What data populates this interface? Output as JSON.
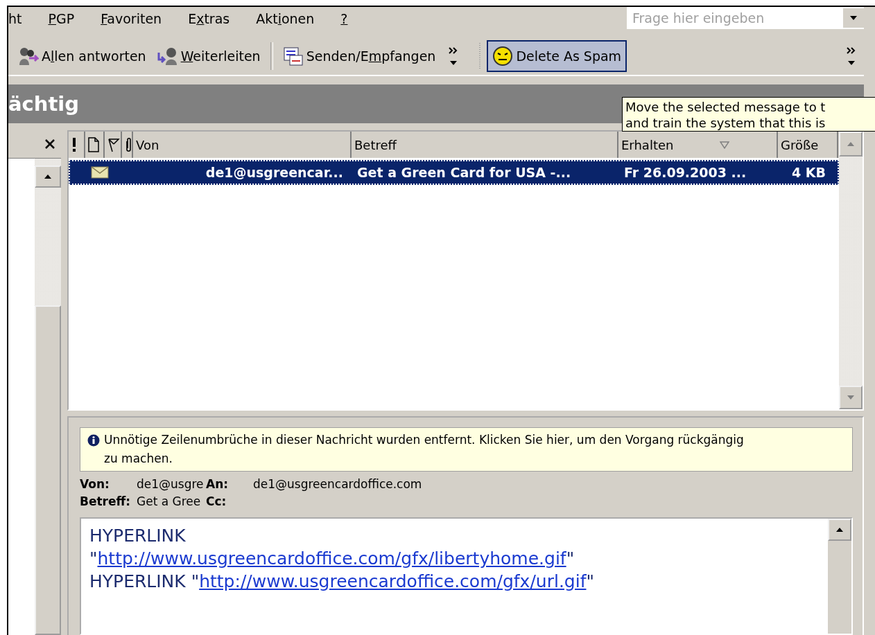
{
  "menu": [
    {
      "pre": "ht"
    },
    {
      "key": "P",
      "post": "GP"
    },
    {
      "key": "F",
      "post": "avoriten"
    },
    {
      "pre": "E",
      "key": "x",
      "post": "tras"
    },
    {
      "pre": "Akt",
      "key": "i",
      "post": "onen"
    },
    {
      "key": "?"
    }
  ],
  "ask_field": {
    "placeholder": "Frage hier eingeben"
  },
  "toolbar": [
    {
      "kind": "reply-all",
      "pre": "A",
      "key": "l",
      "post": "len antworten",
      "selected": false
    },
    {
      "kind": "forward",
      "key": "W",
      "post": "eiterleiten",
      "selected": false
    },
    {
      "kind": "separator"
    },
    {
      "kind": "send-receive",
      "pre": "Senden/E",
      "key": "m",
      "post": "pfangen",
      "selected": false
    },
    {
      "kind": "chevron"
    },
    {
      "kind": "gripper"
    },
    {
      "kind": "spam",
      "pre": "Delete As Spam",
      "selected": true
    },
    {
      "kind": "spacer"
    },
    {
      "kind": "chevron"
    }
  ],
  "folder_title": "ächtig",
  "tooltip": {
    "lines": [
      "Move the selected message to t",
      "and train the system that this is"
    ]
  },
  "message_list": {
    "columns": [
      {
        "kind": "importance"
      },
      {
        "kind": "type"
      },
      {
        "kind": "flag"
      },
      {
        "kind": "attachment"
      },
      {
        "kind": "text",
        "label": "Von",
        "sorted": false
      },
      {
        "kind": "text",
        "label": "Betreff",
        "sorted": false
      },
      {
        "kind": "text",
        "label": "Erhalten",
        "sorted": true
      },
      {
        "kind": "text",
        "label": "Größe",
        "sorted": false
      }
    ],
    "rows": [
      {
        "selected": true,
        "unread": true,
        "from": "de1@usgreencar...",
        "subject": "Get a Green Card for USA -...",
        "received": "Fr 26.09.2003 ...",
        "size": "4 KB"
      }
    ]
  },
  "reading_pane": {
    "info": "Unnötige Zeilenumbrüche in dieser Nachricht wurden entfernt. Klicken Sie hier, um den Vorgang rückgängig zu machen.",
    "fields": [
      {
        "label": "Von:",
        "value": "de1@usgre"
      },
      {
        "label": "An:",
        "value": "de1@usgreencardoffice.com"
      },
      {
        "label": "Betreff:",
        "value": "Get a Gree"
      },
      {
        "label": "Cc:"
      }
    ],
    "body": [
      [
        {
          "kind": "text",
          "text": "HYPERLINK"
        }
      ],
      [
        {
          "kind": "text",
          "text": "\""
        },
        {
          "kind": "link",
          "text": "http://www.usgreencardoffice.com/gfx/libertyhome.gif"
        },
        {
          "kind": "text",
          "text": "\""
        }
      ],
      [
        {
          "kind": "text",
          "text": "HYPERLINK \""
        },
        {
          "kind": "link",
          "text": "http://www.usgreencardoffice.com/gfx/url.gif"
        },
        {
          "kind": "text",
          "text": "\""
        }
      ]
    ]
  }
}
